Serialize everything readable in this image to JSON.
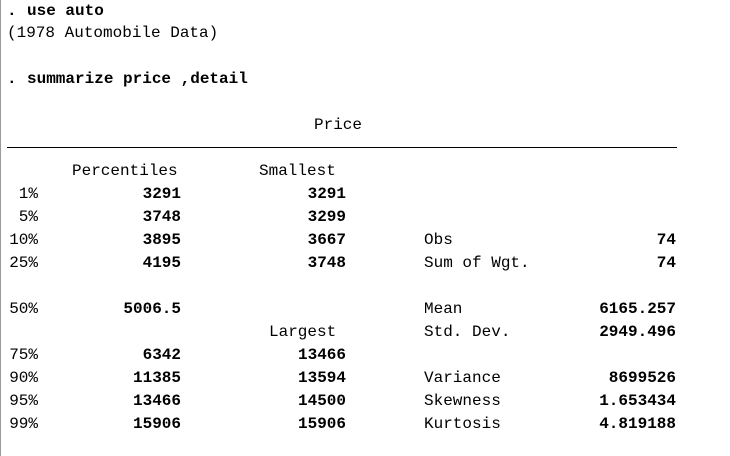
{
  "commands": [
    {
      "prompt": ".",
      "text": "use auto"
    },
    {
      "prompt": ".",
      "text": "summarize price ,detail"
    }
  ],
  "dataset_label": "(1978 Automobile Data)",
  "variable_title": "Price",
  "headers": {
    "percentiles": "Percentiles",
    "smallest": "Smallest",
    "largest": "Largest"
  },
  "rows": [
    {
      "pct": "1%",
      "percentile": "3291",
      "extreme": "3291"
    },
    {
      "pct": "5%",
      "percentile": "3748",
      "extreme": "3299"
    },
    {
      "pct": "10%",
      "percentile": "3895",
      "extreme": "3667"
    },
    {
      "pct": "25%",
      "percentile": "4195",
      "extreme": "3748"
    },
    {
      "pct": "50%",
      "percentile": "5006.5",
      "extreme": ""
    },
    {
      "pct": "75%",
      "percentile": "6342",
      "extreme": "13466"
    },
    {
      "pct": "90%",
      "percentile": "11385",
      "extreme": "13594"
    },
    {
      "pct": "95%",
      "percentile": "13466",
      "extreme": "14500"
    },
    {
      "pct": "99%",
      "percentile": "15906",
      "extreme": "15906"
    }
  ],
  "stats": [
    {
      "label": "Obs",
      "value": "74"
    },
    {
      "label": "Sum of Wgt.",
      "value": "74"
    },
    {
      "label": "Mean",
      "value": "6165.257"
    },
    {
      "label": "Std. Dev.",
      "value": "2949.496"
    },
    {
      "label": "Variance",
      "value": "8699526"
    },
    {
      "label": "Skewness",
      "value": "1.653434"
    },
    {
      "label": "Kurtosis",
      "value": "4.819188"
    }
  ]
}
